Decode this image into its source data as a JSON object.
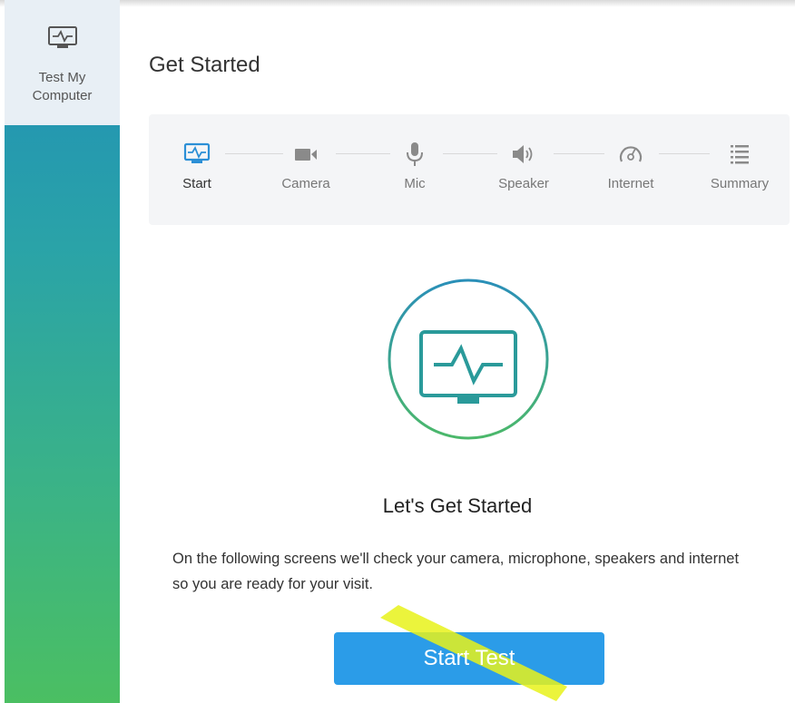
{
  "sidebar": {
    "items": [
      {
        "label": "Test My Computer",
        "icon": "monitor-pulse-icon"
      }
    ],
    "gradient_colors": [
      "#1f8db8",
      "#4bbf62"
    ]
  },
  "main": {
    "title": "Get Started",
    "steps": [
      {
        "label": "Start",
        "icon": "monitor-pulse-icon",
        "active": true
      },
      {
        "label": "Camera",
        "icon": "camera-icon",
        "active": false
      },
      {
        "label": "Mic",
        "icon": "microphone-icon",
        "active": false
      },
      {
        "label": "Speaker",
        "icon": "speaker-icon",
        "active": false
      },
      {
        "label": "Internet",
        "icon": "speedometer-icon",
        "active": false
      },
      {
        "label": "Summary",
        "icon": "list-icon",
        "active": false
      }
    ],
    "hero_icon": "monitor-pulse-icon",
    "subtitle": "Let's Get Started",
    "description": "On the following screens we'll check your camera, microphone, speakers and internet so you are ready for your visit.",
    "start_button_label": "Start Test"
  },
  "colors": {
    "accent": "#2b9ce8",
    "icon_teal": "#2a9a9a",
    "active_step": "#2b8fd6",
    "highlighter": "#e8f21a"
  }
}
